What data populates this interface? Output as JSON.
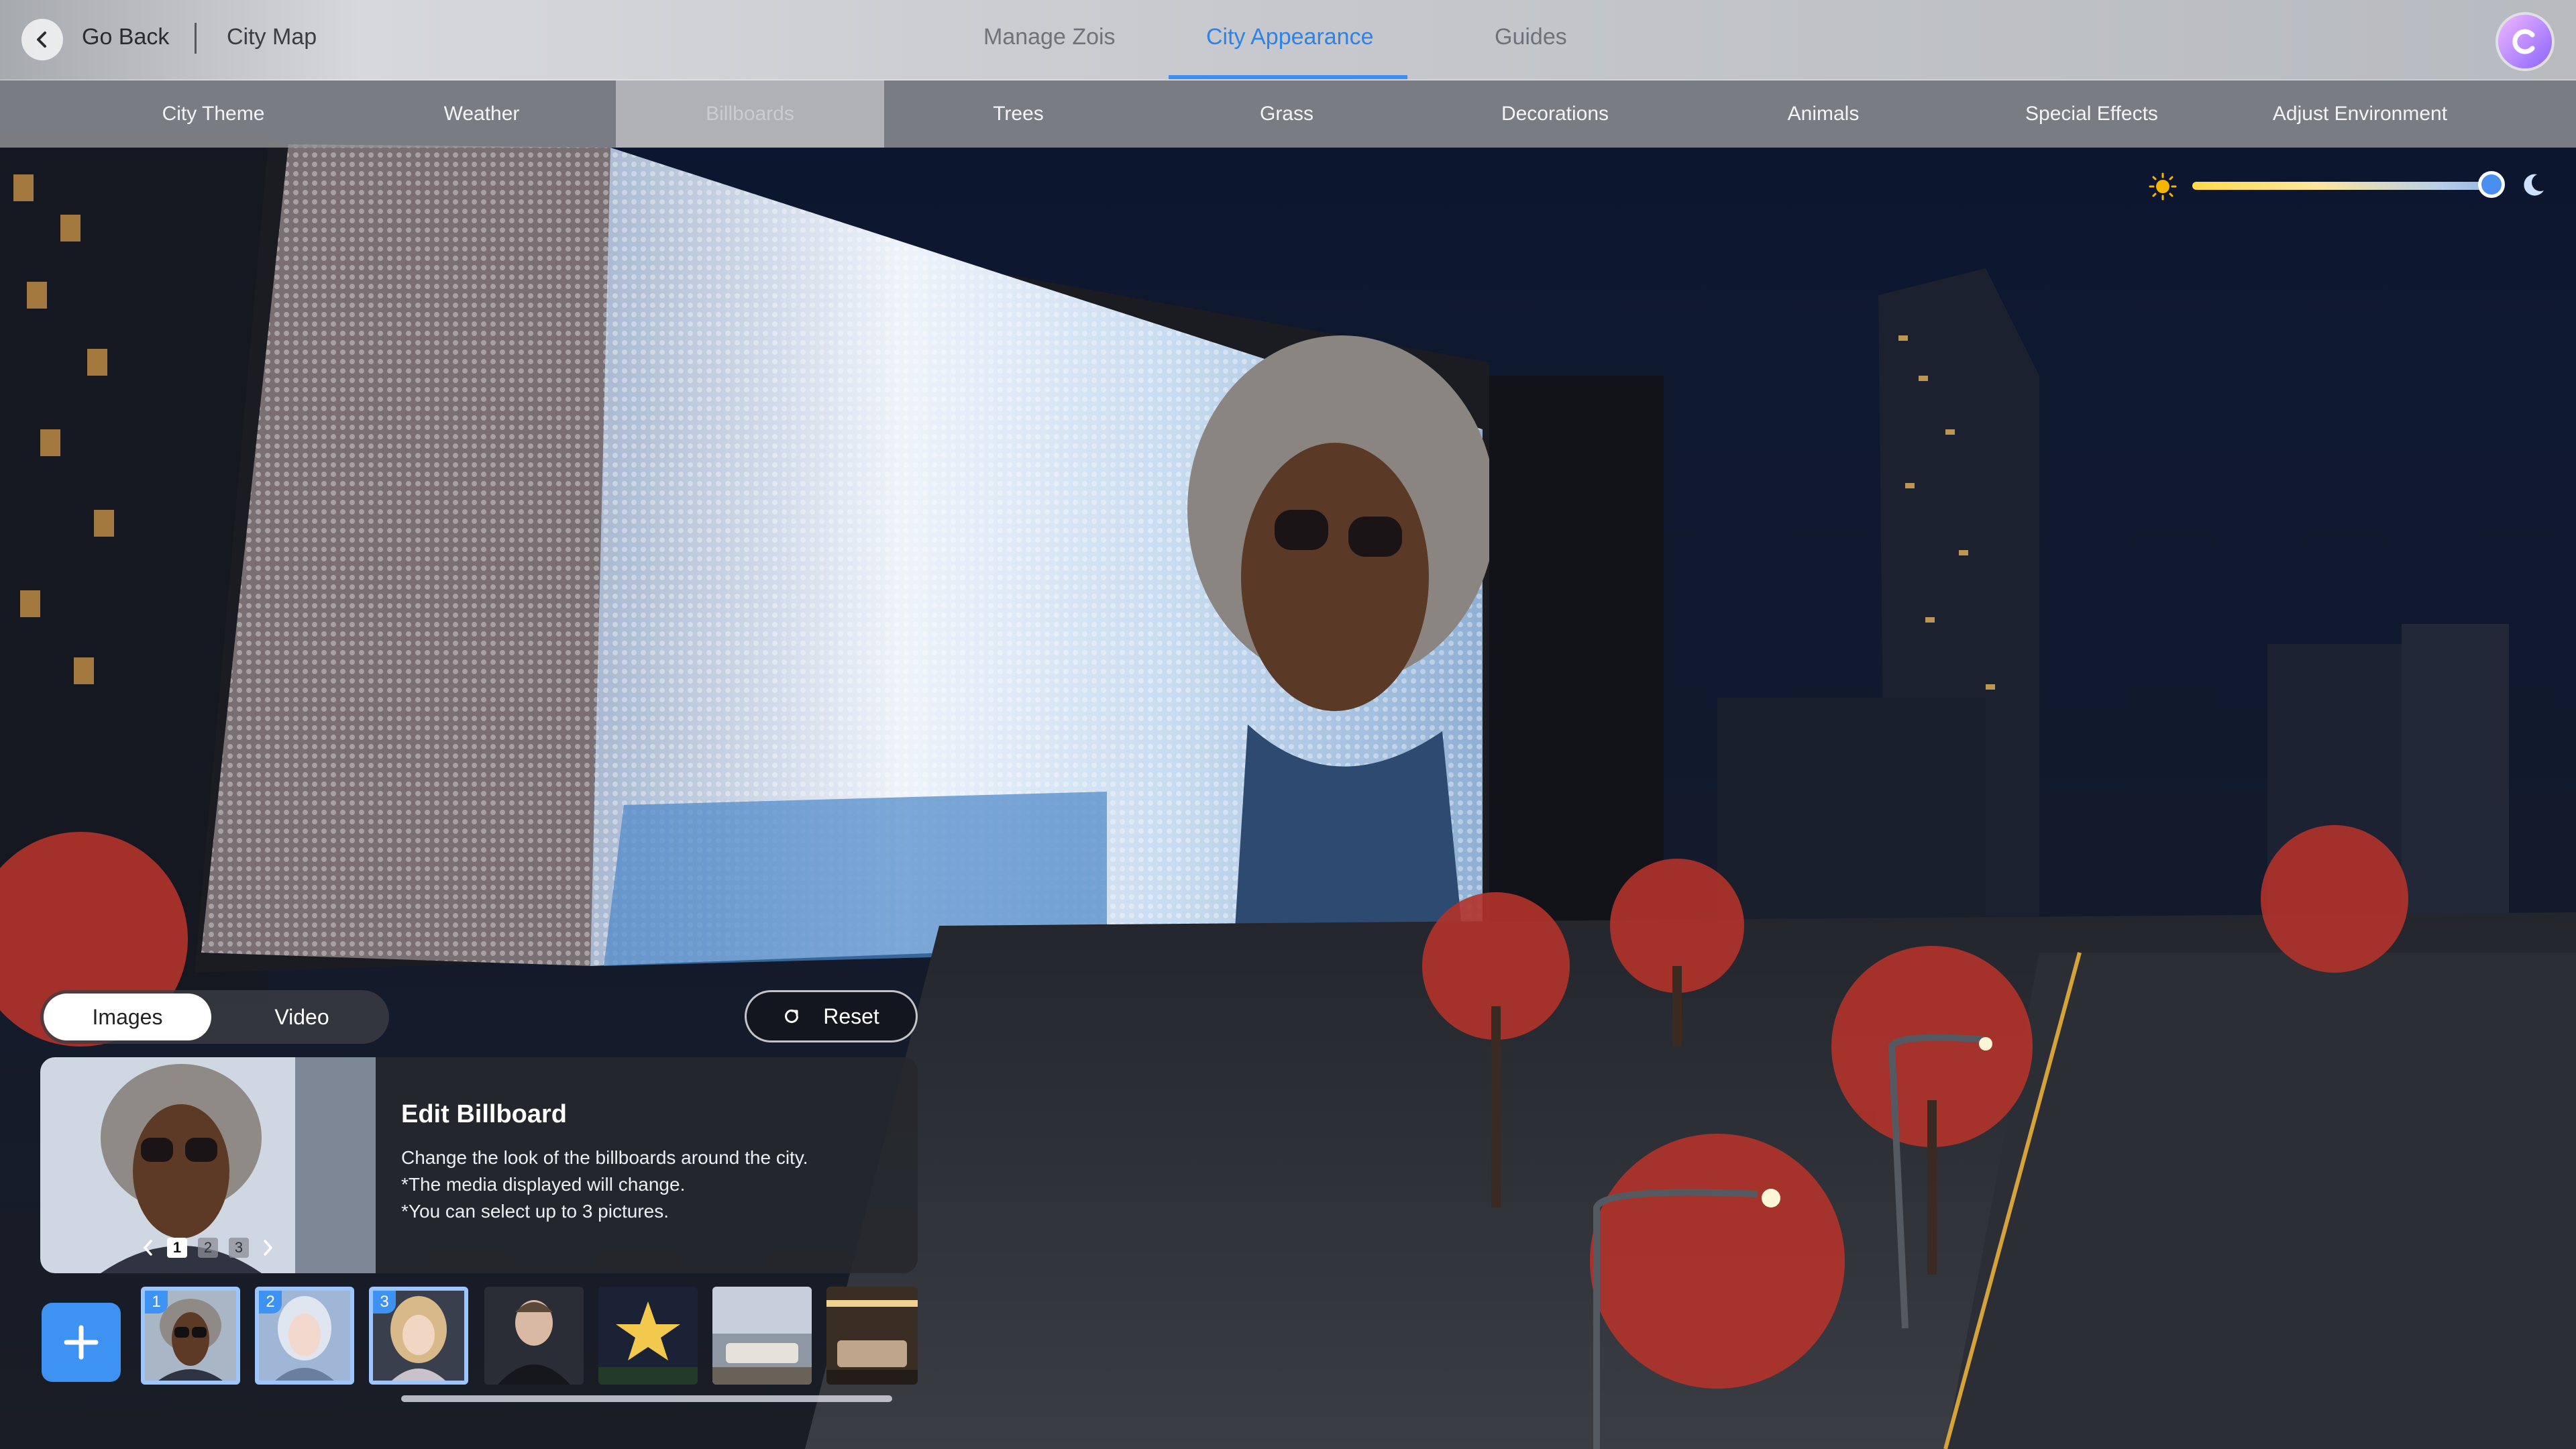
{
  "topbar": {
    "back_label": "Go Back",
    "map_label": "City Map",
    "tabs": [
      {
        "label": "Manage Zois",
        "active": false
      },
      {
        "label": "City Appearance",
        "active": true
      },
      {
        "label": "Guides",
        "active": false
      }
    ],
    "avatar_letter": "C"
  },
  "subtabs": [
    {
      "label": "City Theme",
      "active": false
    },
    {
      "label": "Weather",
      "active": false
    },
    {
      "label": "Billboards",
      "active": true
    },
    {
      "label": "Trees",
      "active": false
    },
    {
      "label": "Grass",
      "active": false
    },
    {
      "label": "Decorations",
      "active": false
    },
    {
      "label": "Animals",
      "active": false
    },
    {
      "label": "Special Effects",
      "active": false
    },
    {
      "label": "Adjust Environment",
      "active": false
    }
  ],
  "time_slider": {
    "value": 0.97,
    "start_icon": "sun-icon",
    "end_icon": "moon-icon"
  },
  "media_toggle": {
    "images_label": "Images",
    "video_label": "Video",
    "selected": "Images"
  },
  "reset_label": "Reset",
  "edit_card": {
    "title": "Edit Billboard",
    "lines": [
      "Change the look of the billboards around the city.",
      "*The media displayed will change.",
      "*You can select up to 3 pictures."
    ],
    "pages": [
      "1",
      "2",
      "3"
    ],
    "current_page": "1"
  },
  "thumbnails": [
    {
      "badge": "1",
      "selected": true,
      "subject": "woman-curly-hair-sunglasses"
    },
    {
      "badge": "2",
      "selected": true,
      "subject": "woman-silver-hair"
    },
    {
      "badge": "3",
      "selected": true,
      "subject": "woman-blonde-night"
    },
    {
      "badge": "",
      "selected": false,
      "subject": "man-dark-jacket"
    },
    {
      "badge": "",
      "selected": false,
      "subject": "gold-star-lights"
    },
    {
      "badge": "",
      "selected": false,
      "subject": "modern-living-room"
    },
    {
      "badge": "",
      "selected": false,
      "subject": "lounge-interior"
    }
  ],
  "colors": {
    "accent": "#3e92f2",
    "active_tab": "#2f83e6"
  }
}
